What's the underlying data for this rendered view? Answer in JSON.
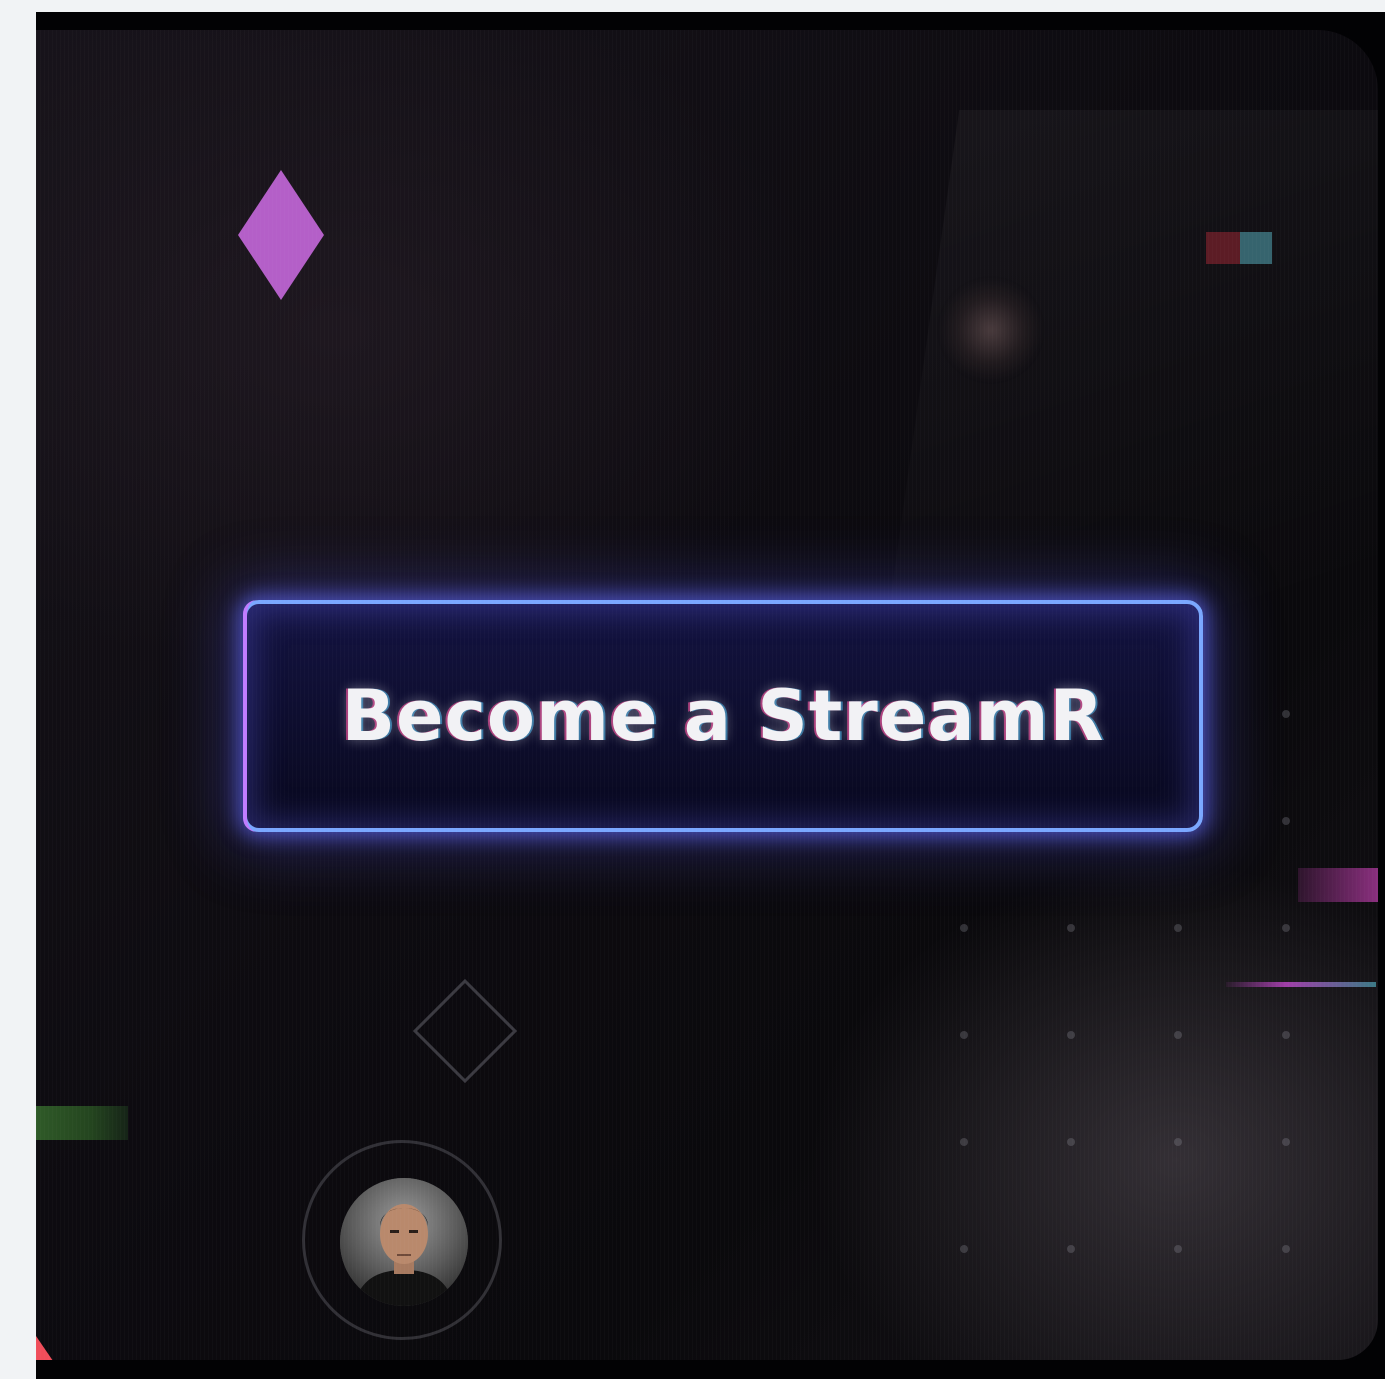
{
  "cta": {
    "label": "Become a StreamR"
  },
  "avatar": {
    "icon": "user-avatar-photo"
  },
  "decor": {
    "diamond_color": "#b45fc8",
    "button_border_color": "#7aa7ff",
    "button_border_accent": "#c07cff",
    "corner_triangle_color": "#ef4d5a"
  },
  "icons": [
    "diamond-solid-icon",
    "diamond-outline-icon",
    "corner-triangle-icon"
  ]
}
